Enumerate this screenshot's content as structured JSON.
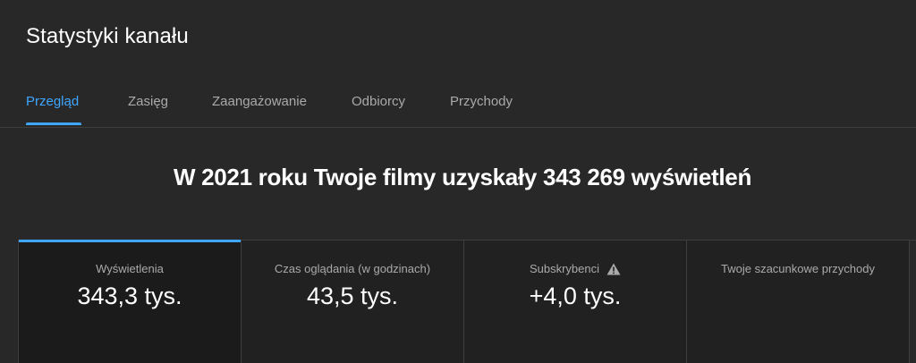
{
  "header": {
    "title": "Statystyki kanału"
  },
  "tabs": [
    {
      "label": "Przegląd",
      "active": true
    },
    {
      "label": "Zasięg",
      "active": false
    },
    {
      "label": "Zaangażowanie",
      "active": false
    },
    {
      "label": "Odbiorcy",
      "active": false
    },
    {
      "label": "Przychody",
      "active": false
    }
  ],
  "headline": "W 2021 roku Twoje filmy uzyskały 343 269 wyświetleń",
  "cards": [
    {
      "label": "Wyświetlenia",
      "value": "343,3 tys.",
      "active": true
    },
    {
      "label": "Czas oglądania (w godzinach)",
      "value": "43,5 tys.",
      "active": false
    },
    {
      "label": "Subskrybenci",
      "value": "+4,0 tys.",
      "active": false,
      "icon": "warning-icon"
    },
    {
      "label": "Twoje szacunkowe przychody",
      "value": "",
      "active": false
    }
  ],
  "colors": {
    "background": "#282828",
    "accent": "#3ea6ff",
    "text": "#ffffff",
    "muted": "#aaaaaa"
  }
}
